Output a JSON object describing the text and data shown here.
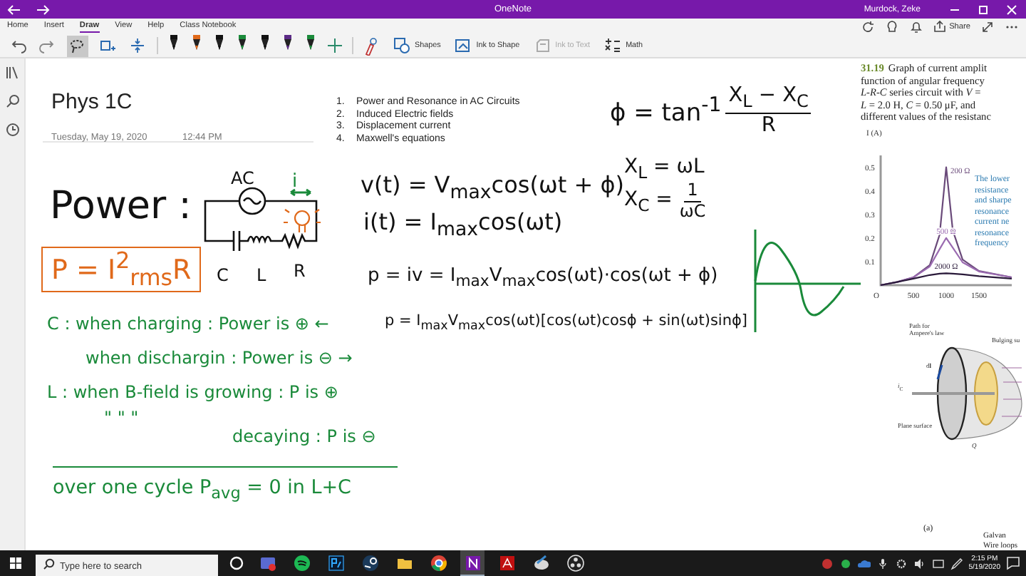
{
  "window": {
    "title": "OneNote",
    "user": "Murdock, Zeke"
  },
  "ribbon_tabs": [
    {
      "label": "Home",
      "selected": false
    },
    {
      "label": "Insert",
      "selected": false
    },
    {
      "label": "Draw",
      "selected": true
    },
    {
      "label": "View",
      "selected": false
    },
    {
      "label": "Help",
      "selected": false
    },
    {
      "label": "Class Notebook",
      "selected": false
    }
  ],
  "share_button": "Share",
  "tools": [
    {
      "kind": "undo",
      "selected": false
    },
    {
      "kind": "redo",
      "selected": false
    },
    {
      "kind": "lasso",
      "selected": true
    },
    {
      "kind": "add-space",
      "selected": false
    },
    {
      "kind": "eraser",
      "selected": false
    }
  ],
  "pens": [
    {
      "color": "#111111"
    },
    {
      "color": "#e0691a"
    },
    {
      "color": "#111111"
    },
    {
      "color": "#1a8a3a"
    },
    {
      "color": "#111111"
    },
    {
      "color": "#5b2a86"
    },
    {
      "color": "#1a8a3a"
    }
  ],
  "toolbar_buttons": [
    {
      "kind": "shapes",
      "label": "Shapes",
      "disabled": false
    },
    {
      "kind": "ink-to-shape",
      "label": "Ink to Shape",
      "disabled": false
    },
    {
      "kind": "ink-to-text",
      "label": "Ink to Text",
      "disabled": true
    },
    {
      "kind": "math",
      "label": "Math",
      "disabled": false
    }
  ],
  "page": {
    "title": "Phys 1C",
    "date": "Tuesday, May 19, 2020",
    "time": "12:44 PM",
    "outline": [
      {
        "number": "1.",
        "text": "Power and Resonance in AC Circuits"
      },
      {
        "number": "2.",
        "text": "Induced Electric fields"
      },
      {
        "number": "3.",
        "text": "Displacement current"
      },
      {
        "number": "4.",
        "text": "Maxwell's equations"
      }
    ]
  },
  "ink": [
    {
      "kind": "text",
      "color": "#111111",
      "text": "Power :"
    },
    {
      "kind": "boxed",
      "color": "#e0691a",
      "text": "P = I$^{2}$$_{rms}$R"
    },
    {
      "kind": "circuit",
      "color": "#111111"
    },
    {
      "kind": "text",
      "color": "#111111",
      "text": "AC"
    },
    {
      "kind": "text",
      "color": "#1a8a3a",
      "text": "i"
    },
    {
      "kind": "text",
      "color": "#111111",
      "text": "C"
    },
    {
      "kind": "text",
      "color": "#111111",
      "text": "L"
    },
    {
      "kind": "text",
      "color": "#111111",
      "text": "R"
    },
    {
      "kind": "text",
      "color": "#111111",
      "text": "v(t) = V$_{max}$cos(ωt + ϕ)"
    },
    {
      "kind": "text",
      "color": "#111111",
      "text": "i(t) = I$_{max}$cos(ωt)"
    },
    {
      "kind": "fraction",
      "color": "#111111",
      "lead": "ϕ = tan$^{-1}$",
      "numerator": "X$_{L}$ − X$_{C}$",
      "denominator": "R"
    },
    {
      "kind": "text",
      "color": "#111111",
      "text": "X$_{L}$ = ωL"
    },
    {
      "kind": "fraction",
      "color": "#111111",
      "lead": "X$_{C}$ =",
      "numerator": "1",
      "denominator": "ωC"
    },
    {
      "kind": "text",
      "color": "#111111",
      "text": "p = iv = I$_{max}$V$_{max}$cos(ωt)·cos(ωt + ϕ)"
    },
    {
      "kind": "wave",
      "color": "#1a8a3a"
    },
    {
      "kind": "text",
      "color": "#1a8a3a",
      "text": "C : when charging : Power is ⊕ ←"
    },
    {
      "kind": "text",
      "color": "#111111",
      "text": "p = I$_{max}$V$_{max}$cos(ωt)[cos(ωt)cosϕ + sin(ωt)sinϕ]"
    },
    {
      "kind": "text",
      "color": "#1a8a3a",
      "text": "when dischargin : Power is ⊖ →"
    },
    {
      "kind": "text",
      "color": "#1a8a3a",
      "text": "L : when B-field is growing : P is ⊕"
    },
    {
      "kind": "text",
      "color": "#1a8a3a",
      "text": "\"          \"          \""
    },
    {
      "kind": "text",
      "color": "#1a8a3a",
      "text": "decaying : P is ⊖"
    },
    {
      "kind": "rule",
      "color": "#1a8a3a"
    },
    {
      "kind": "text",
      "color": "#1a8a3a",
      "text": "over one cycle P$_{avg}$ = 0 in L+C"
    }
  ],
  "textbook": {
    "figure_number": "31.19",
    "caption_lines": [
      "Graph of current amplit",
      "function of angular frequency",
      "*L-R-C* series circuit with *V* =",
      "*L* = 2.0 H, *C* = 0.50 μF, and",
      "different values of the resistanc"
    ],
    "chart_data": {
      "type": "line",
      "ylabel": "I (A)",
      "x": [
        0,
        250,
        500,
        750,
        900,
        1000,
        1100,
        1250,
        1500,
        2000
      ],
      "series": [
        {
          "name": "200 Ω",
          "color": "#6a4a7a",
          "values": [
            0,
            0.013,
            0.033,
            0.085,
            0.214,
            0.5,
            0.232,
            0.108,
            0.06,
            0.033
          ]
        },
        {
          "name": "500 Ω",
          "color": "#9a6ab0",
          "values": [
            0,
            0.013,
            0.033,
            0.079,
            0.153,
            0.2,
            0.159,
            0.097,
            0.058,
            0.033
          ]
        },
        {
          "name": "2000 Ω",
          "color": "#2a1a3a",
          "values": [
            0,
            0.013,
            0.028,
            0.043,
            0.049,
            0.05,
            0.049,
            0.046,
            0.038,
            0.028
          ]
        }
      ],
      "xlim": [
        0,
        2000
      ],
      "ylim": [
        0,
        0.55
      ],
      "xticks": [
        500,
        1000,
        1500
      ],
      "yticks": [
        0.1,
        0.2,
        0.3,
        0.4,
        0.5
      ]
    },
    "origin_label": "O",
    "callout_lines": [
      "The lower",
      "resistance",
      "and sharpe",
      "resonance",
      "current ne",
      "resonance",
      "frequency"
    ],
    "figure_labels": [
      {
        "kind": "path",
        "text": "Path for Ampere's law"
      },
      {
        "kind": "bulging",
        "text": "Bulging su"
      },
      {
        "kind": "dl",
        "text": "d**l**"
      },
      {
        "kind": "ic",
        "text": "*i*$_{C}$"
      },
      {
        "kind": "plane",
        "text": "Plane surface"
      },
      {
        "kind": "q",
        "text": "*Q*"
      }
    ],
    "figure_caption": "(a)",
    "bottom_labels": [
      "Galvan",
      "Wire loops"
    ]
  },
  "taskbar": {
    "search_placeholder": "Type here to search",
    "apps": [
      {
        "kind": "mail",
        "selected": false
      },
      {
        "kind": "spotify",
        "selected": false
      },
      {
        "kind": "photoshop",
        "selected": false
      },
      {
        "kind": "steam",
        "selected": false
      },
      {
        "kind": "files",
        "selected": false
      },
      {
        "kind": "chrome",
        "selected": false
      },
      {
        "kind": "onenote",
        "selected": true
      },
      {
        "kind": "acrobat",
        "selected": false
      },
      {
        "kind": "paint",
        "selected": false
      },
      {
        "kind": "obs",
        "selected": false
      }
    ],
    "time": "2:15 PM",
    "date": "5/19/2020"
  }
}
